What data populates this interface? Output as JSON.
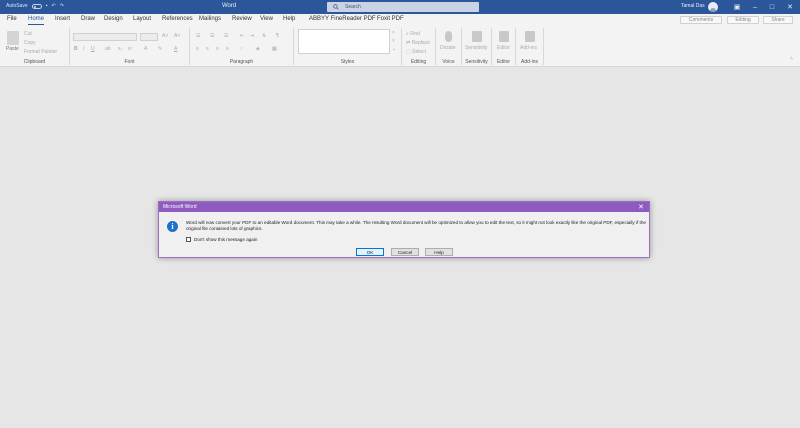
{
  "titlebar": {
    "autosave": "AutoSave",
    "app_title": "Word",
    "search_placeholder": "Search",
    "user_name": "Tamal Das"
  },
  "menu": {
    "tabs": [
      "File",
      "Home",
      "Insert",
      "Draw",
      "Design",
      "Layout",
      "References",
      "Mailings",
      "Review",
      "View",
      "Help",
      "ABBYY FineReader PDF",
      "Foxit PDF"
    ],
    "active": "Home",
    "right_buttons": {
      "comments": "Comments",
      "editing": "Editing",
      "share": "Share"
    }
  },
  "ribbon": {
    "clipboard": {
      "paste": "Paste",
      "cut": "Cut",
      "copy": "Copy",
      "format_painter": "Format Painter",
      "label": "Clipboard"
    },
    "font": {
      "label": "Font"
    },
    "paragraph": {
      "label": "Paragraph"
    },
    "styles": {
      "label": "Styles"
    },
    "editing": {
      "find": "Find",
      "replace": "Replace",
      "select": "Select",
      "label": "Editing"
    },
    "voice": {
      "dictate": "Dictate",
      "label": "Voice"
    },
    "sensitivity": {
      "button": "Sensitivity",
      "label": "Sensitivity"
    },
    "editor": {
      "button": "Editor",
      "label": "Editor"
    },
    "addins": {
      "button": "Add-ins",
      "label": "Add-ins"
    }
  },
  "dialog": {
    "title": "Microsoft Word",
    "message": "Word will now convert your PDF to an editable Word document. This may take a while. The resulting Word document will be optimized to allow you to edit the text, so it might not look exactly like the original PDF, especially if the original file contained lots of graphics.",
    "checkbox_label": "Don't show this message again",
    "ok": "OK",
    "cancel": "Cancel",
    "help": "Help"
  },
  "colors": {
    "titlebar": "#2b579a",
    "dialog_title": "#8e5cc0",
    "info_icon": "#1e73c8"
  }
}
